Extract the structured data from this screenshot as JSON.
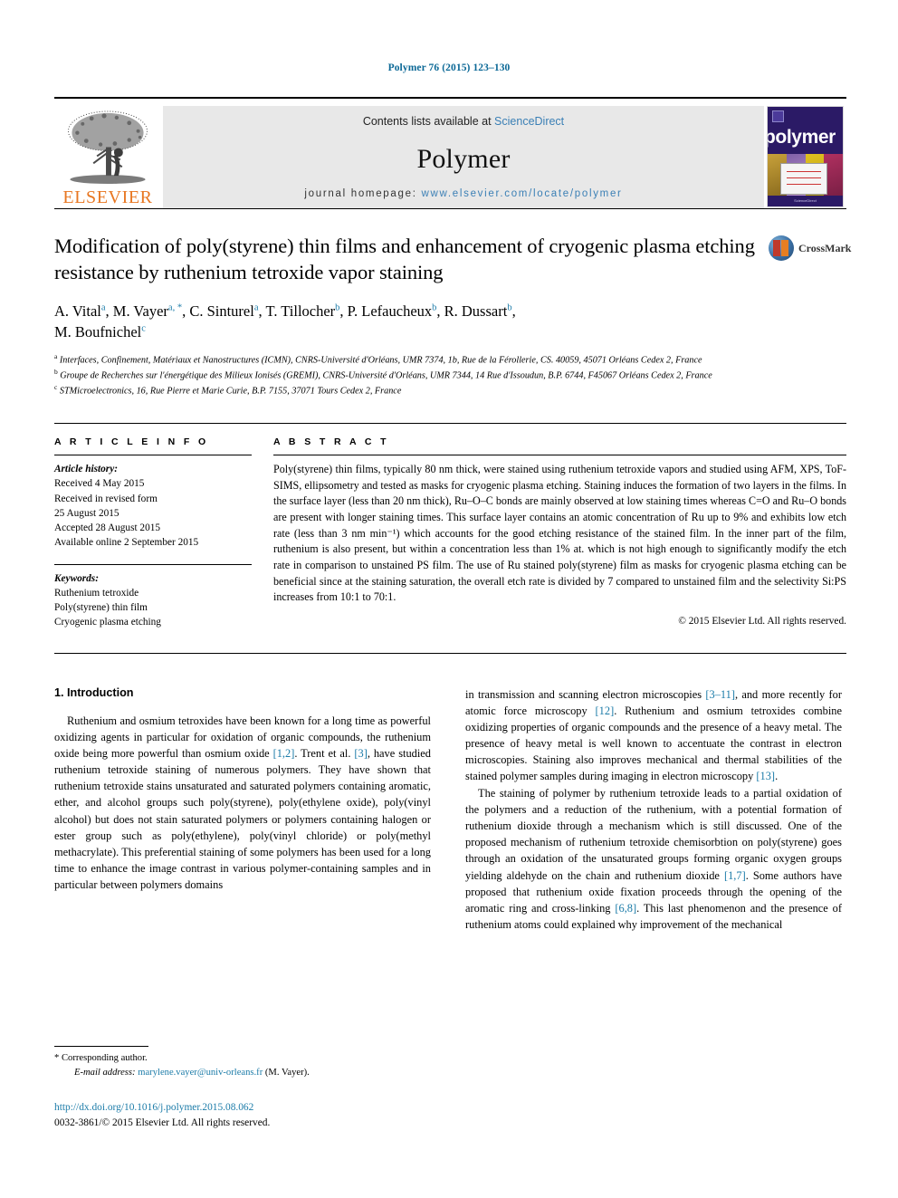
{
  "running_head": "Polymer 76 (2015) 123–130",
  "masthead": {
    "publisher_wordmark": "ELSEVIER",
    "contents_prefix": "Contents lists available at",
    "sciencedirect": "ScienceDirect",
    "journal_title": "Polymer",
    "homepage_label": "journal homepage:",
    "homepage_url": "www.elsevier.com/locate/polymer",
    "cover_wordmark": "polymer",
    "cover_footer": "ScienceDirect",
    "accent_blue": "#3a7fb5",
    "elsevier_orange": "#E87722"
  },
  "article": {
    "title": "Modification of poly(styrene) thin films and enhancement of cryogenic plasma etching resistance by ruthenium tetroxide vapor staining",
    "crossmark_label": "CrossMark",
    "authors_line_1": "A. Vital a, M. Vayer a, *, C. Sinturel a, T. Tillocher b, P. Lefaucheux b, R. Dussart b,",
    "authors_line_2": "M. Boufnichel c",
    "authors": [
      {
        "name": "A. Vital",
        "sup": "a",
        "sep": ", "
      },
      {
        "name": "M. Vayer",
        "sup": "a, *",
        "sep": ", "
      },
      {
        "name": "C. Sinturel",
        "sup": "a",
        "sep": ", "
      },
      {
        "name": "T. Tillocher",
        "sup": "b",
        "sep": ", "
      },
      {
        "name": "P. Lefaucheux",
        "sup": "b",
        "sep": ", "
      },
      {
        "name": "R. Dussart",
        "sup": "b",
        "sep": ","
      },
      {
        "name": "M. Boufnichel",
        "sup": "c",
        "sep": ""
      }
    ],
    "affiliations": [
      {
        "marker": "a",
        "text": "Interfaces, Confinement, Matériaux et Nanostructures (ICMN), CNRS-Université d'Orléans, UMR 7374, 1b, Rue de la Férollerie, CS. 40059, 45071 Orléans Cedex 2, France"
      },
      {
        "marker": "b",
        "text": "Groupe de Recherches sur l'énergétique des Milieux Ionisés (GREMI), CNRS-Université d'Orléans, UMR 7344, 14 Rue d'Issoudun, B.P. 6744, F45067 Orléans Cedex 2, France"
      },
      {
        "marker": "c",
        "text": "STMicroelectronics, 16, Rue Pierre et Marie Curie, B.P. 7155, 37071 Tours Cedex 2, France"
      }
    ]
  },
  "article_info": {
    "heading": "A R T I C L E   I N F O",
    "history_label": "Article history:",
    "history": [
      "Received 4 May 2015",
      "Received in revised form",
      "25 August 2015",
      "Accepted 28 August 2015",
      "Available online 2 September 2015"
    ],
    "keywords_label": "Keywords:",
    "keywords": [
      "Ruthenium tetroxide",
      "Poly(styrene) thin film",
      "Cryogenic plasma etching"
    ]
  },
  "abstract": {
    "heading": "A B S T R A C T",
    "text": "Poly(styrene) thin films, typically 80 nm thick, were stained using ruthenium tetroxide vapors and studied using AFM, XPS, ToF-SIMS, ellipsometry and tested as masks for cryogenic plasma etching. Staining induces the formation of two layers in the films. In the surface layer (less than 20 nm thick), Ru–O–C bonds are mainly observed at low staining times whereas C=O and Ru–O bonds are present with longer staining times. This surface layer contains an atomic concentration of Ru up to 9% and exhibits low etch rate (less than 3 nm min⁻¹) which accounts for the good etching resistance of the stained film. In the inner part of the film, ruthenium is also present, but within a concentration less than 1% at. which is not high enough to significantly modify the etch rate in comparison to unstained PS film. The use of Ru stained poly(styrene) film as masks for cryogenic plasma etching can be beneficial since at the staining saturation, the overall etch rate is divided by 7 compared to unstained film and the selectivity Si:PS increases from 10:1 to 70:1.",
    "copyright": "© 2015 Elsevier Ltd. All rights reserved."
  },
  "body": {
    "section_heading": "1. Introduction",
    "left_paragraph": "Ruthenium and osmium tetroxides have been known for a long time as powerful oxidizing agents in particular for oxidation of organic compounds, the ruthenium oxide being more powerful than osmium oxide [1,2]. Trent et al. [3], have studied ruthenium tetroxide staining of numerous polymers. They have shown that ruthenium tetroxide stains unsaturated and saturated polymers containing aromatic, ether, and alcohol groups such poly(styrene), poly(ethylene oxide), poly(vinyl alcohol) but does not stain saturated polymers or polymers containing halogen or ester group such as poly(ethylene), poly(vinyl chloride) or poly(methyl methacrylate). This preferential staining of some polymers has been used for a long time to enhance the image contrast in various polymer-containing samples and in particular between polymers domains",
    "right_paragraph_1": "in transmission and scanning electron microscopies [3–11], and more recently for atomic force microscopy [12]. Ruthenium and osmium tetroxides combine oxidizing properties of organic compounds and the presence of a heavy metal. The presence of heavy metal is well known to accentuate the contrast in electron microscopies. Staining also improves mechanical and thermal stabilities of the stained polymer samples during imaging in electron microscopy [13].",
    "right_paragraph_2": "The staining of polymer by ruthenium tetroxide leads to a partial oxidation of the polymers and a reduction of the ruthenium, with a potential formation of ruthenium dioxide through a mechanism which is still discussed. One of the proposed mechanism of ruthenium tetroxide chemisorbtion on poly(styrene) goes through an oxidation of the unsaturated groups forming organic oxygen groups yielding aldehyde on the chain and ruthenium dioxide [1,7]. Some authors have proposed that ruthenium oxide fixation proceeds through the opening of the aromatic ring and cross-linking [6,8]. This last phenomenon and the presence of ruthenium atoms could explained why improvement of the mechanical"
  },
  "footnote": {
    "corresponding_marker": "*",
    "corresponding_label": "Corresponding author.",
    "email_label": "E-mail address:",
    "email": "marylene.vayer@univ-orleans.fr",
    "email_owner": "(M. Vayer).",
    "doi": "http://dx.doi.org/10.1016/j.polymer.2015.08.062",
    "issn_line": "0032-3861/© 2015 Elsevier Ltd. All rights reserved."
  }
}
